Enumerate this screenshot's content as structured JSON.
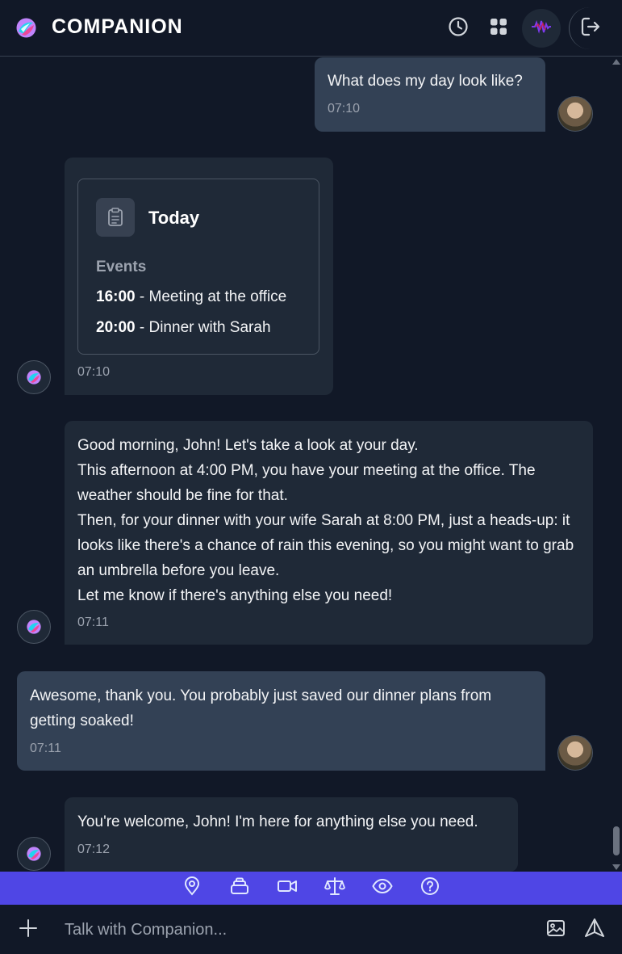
{
  "app": {
    "title": "COMPANION"
  },
  "header": {
    "icons": [
      "history-icon",
      "apps-grid-icon",
      "voice-wave-icon",
      "logout-icon"
    ]
  },
  "messages": [
    {
      "sender": "user",
      "text": "What does my day look like?",
      "time": "07:10"
    },
    {
      "sender": "bot",
      "card": {
        "title": "Today",
        "section_label": "Events",
        "events": [
          {
            "time": "16:00",
            "desc": " - Meeting at the office"
          },
          {
            "time": "20:00",
            "desc": " - Dinner with Sarah"
          }
        ]
      },
      "time": "07:10"
    },
    {
      "sender": "bot",
      "lines": [
        "Good morning, John! Let's take a look at your day.",
        "This afternoon at 4:00 PM, you have your meeting at the office. The weather should be fine for that.",
        "Then, for your dinner with your wife Sarah at 8:00 PM, just a heads-up: it looks like there's a chance of rain this evening, so you might want to grab an umbrella before you leave.",
        "Let me know if there's anything else you need!"
      ],
      "time": "07:11"
    },
    {
      "sender": "user",
      "text": "Awesome, thank you. You probably just saved our dinner plans from getting soaked!",
      "time": "07:11"
    },
    {
      "sender": "bot",
      "text": "You're welcome, John! I'm here for anything else you need.",
      "time": "07:12"
    }
  ],
  "toolbar": {
    "tools": [
      "location-icon",
      "layers-icon",
      "video-icon",
      "scale-icon",
      "eye-icon",
      "help-icon"
    ]
  },
  "input": {
    "placeholder": "Talk with Companion..."
  },
  "colors": {
    "background": "#111827",
    "user_bubble": "#334155",
    "bot_bubble": "#1f2937",
    "toolbar": "#4f46e5"
  }
}
